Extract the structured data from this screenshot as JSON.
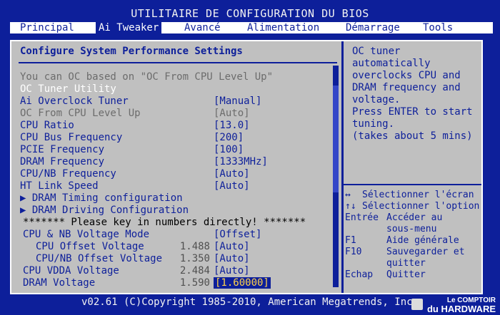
{
  "title": "UTILITAIRE DE CONFIGURATION DU BIOS",
  "menu": [
    {
      "label": "Principal",
      "active": false
    },
    {
      "label": "Ai Tweaker",
      "active": true
    },
    {
      "label": "Avancé",
      "active": false
    },
    {
      "label": "Alimentation",
      "active": false
    },
    {
      "label": "Démarrage",
      "active": false
    },
    {
      "label": "Tools",
      "active": false
    }
  ],
  "main": {
    "heading": "Configure System Performance Settings",
    "rows": [
      {
        "label": "You can OC based on \"OC From CPU Level Up\"",
        "num": "",
        "value": "",
        "label_color": "gray",
        "value_color": "",
        "indent": 0
      },
      {
        "label": "OC Tuner Utility",
        "num": "",
        "value": "",
        "label_color": "white",
        "value_color": "",
        "indent": 0
      },
      {
        "label": "Ai Overclock Tuner",
        "num": "",
        "value": "[Manual]",
        "label_color": "blue",
        "value_color": "blue",
        "indent": 0
      },
      {
        "label": "OC From CPU Level Up",
        "num": "",
        "value": "[Auto]",
        "label_color": "gray",
        "value_color": "gray",
        "indent": 0
      },
      {
        "label": "CPU Ratio",
        "num": "",
        "value": "[13.0]",
        "label_color": "blue",
        "value_color": "blue",
        "indent": 0
      },
      {
        "label": "CPU Bus Frequency",
        "num": "",
        "value": "[200]",
        "label_color": "blue",
        "value_color": "blue",
        "indent": 0
      },
      {
        "label": "PCIE Frequency",
        "num": "",
        "value": "[100]",
        "label_color": "blue",
        "value_color": "blue",
        "indent": 0
      },
      {
        "label": "DRAM Frequency",
        "num": "",
        "value": "[1333MHz]",
        "label_color": "blue",
        "value_color": "blue",
        "indent": 0
      },
      {
        "label": "CPU/NB Frequency",
        "num": "",
        "value": "[Auto]",
        "label_color": "blue",
        "value_color": "blue",
        "indent": 0
      },
      {
        "label": "HT Link Speed",
        "num": "",
        "value": "[Auto]",
        "label_color": "blue",
        "value_color": "blue",
        "indent": 0
      },
      {
        "label": "▶ DRAM Timing configuration",
        "num": "",
        "value": "",
        "label_color": "blue",
        "value_color": "",
        "indent": 0
      },
      {
        "label": "▶ DRAM Driving Configuration",
        "num": "",
        "value": "",
        "label_color": "blue",
        "value_color": "",
        "indent": 0
      },
      {
        "label": "******* Please key in numbers directly! *******",
        "num": "",
        "value": "",
        "label_color": "black",
        "value_color": "",
        "indent": 0
      },
      {
        "label": "CPU & NB Voltage Mode",
        "num": "",
        "value": "[Offset]",
        "label_color": "blue",
        "value_color": "blue",
        "indent": 0
      },
      {
        "label": "CPU Offset Voltage",
        "num": "1.488",
        "value": "[Auto]",
        "label_color": "blue",
        "value_color": "blue",
        "indent": 1
      },
      {
        "label": "CPU/NB Offset Voltage",
        "num": "1.350",
        "value": "[Auto]",
        "label_color": "blue",
        "value_color": "blue",
        "indent": 1
      },
      {
        "label": "CPU VDDA Voltage",
        "num": "2.484",
        "value": "[Auto]",
        "label_color": "blue",
        "value_color": "blue",
        "indent": 0
      },
      {
        "label": "DRAM Voltage",
        "num": "1.590",
        "value": "[1.60000]",
        "label_color": "blue",
        "value_color": "selected",
        "indent": 0
      }
    ]
  },
  "help": {
    "text": "OC tuner automatically\noverclocks CPU and\nDRAM frequency and\nvoltage.\nPress ENTER to start\ntuning.\n(takes about 5 mins)",
    "keys": [
      {
        "key": "↔",
        "desc": "Sélectionner l'écran",
        "full": true
      },
      {
        "key": "↑↓",
        "desc": "Sélectionner l'option",
        "full": true
      },
      {
        "key": "Entrée",
        "desc": "Accéder au",
        "full": true
      },
      {
        "key": "",
        "desc": "sous-menu",
        "full": false
      },
      {
        "key": "F1",
        "desc": "Aide générale",
        "full": false
      },
      {
        "key": "F10",
        "desc": "Sauvegarder et",
        "full": false
      },
      {
        "key": "",
        "desc": "quitter",
        "full": false
      },
      {
        "key": "Echap",
        "desc": "Quitter",
        "full": false
      }
    ]
  },
  "footer": "v02.61 (C)Copyright 1985-2010, American Megatrends, Inc.",
  "watermark": {
    "line1": "Le COMPTOIR",
    "line2": "du HARDWARE"
  }
}
